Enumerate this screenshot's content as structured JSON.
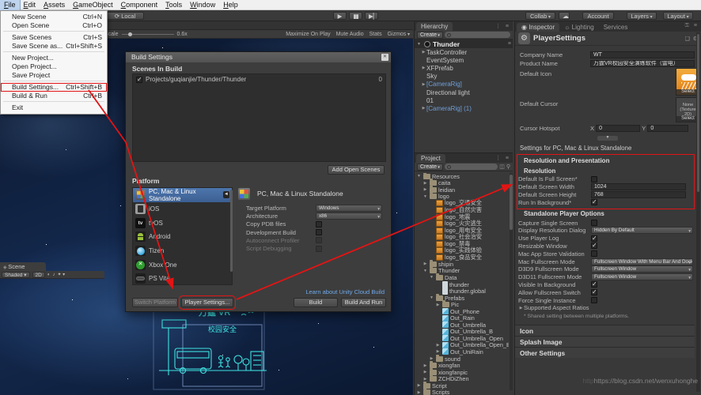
{
  "annotation_color": "#e21414",
  "window": {
    "watermark_ghost": "http",
    "watermark": "https://blog.csdn.net/wenxuhonghe"
  },
  "menu_bar": {
    "active": "File",
    "items": [
      "File",
      "Edit",
      "Assets",
      "GameObject",
      "Component",
      "Tools",
      "Window",
      "Help"
    ]
  },
  "toolbar": {
    "local_label": "Local",
    "collab_label": "Collab",
    "account_label": "Account",
    "layers_label": "Layers",
    "layout_label": "Layout"
  },
  "file_menu": {
    "items": [
      {
        "label": "New Scene",
        "shortcut": "Ctrl+N"
      },
      {
        "label": "Open Scene",
        "shortcut": "Ctrl+O",
        "sep": true
      },
      {
        "label": "Save Scenes",
        "shortcut": "Ctrl+S"
      },
      {
        "label": "Save Scene as...",
        "shortcut": "Ctrl+Shift+S",
        "sep": true
      },
      {
        "label": "New Project..."
      },
      {
        "label": "Open Project..."
      },
      {
        "label": "Save Project",
        "sep": true
      },
      {
        "label": "Build Settings...",
        "shortcut": "Ctrl+Shift+B",
        "boxed": true
      },
      {
        "label": "Build & Run",
        "shortcut": "Ctrl+B",
        "sep": true
      },
      {
        "label": "Exit"
      }
    ]
  },
  "game_view": {
    "scale_label": "Scale",
    "scale_value": "0.6x",
    "buttons": [
      "Maximize On Play",
      "Mute Audio",
      "Stats",
      "Gizmos"
    ],
    "logo_line1": "万霆 VR",
    "logo_line2": "校园安全"
  },
  "scene_view": {
    "tab": "Scene",
    "shading_label": "Shaded",
    "mode_2d_label": "2D"
  },
  "build_settings": {
    "title": "Build Settings",
    "scenes_in_build_label": "Scenes In Build",
    "scenes": [
      {
        "label": "Projects/guqianjie/Thunder/Thunder",
        "checked": true,
        "index": "0"
      }
    ],
    "add_open_scenes_label": "Add Open Scenes",
    "platform_label": "Platform",
    "platforms": [
      {
        "label": "PC, Mac & Linux Standalone",
        "icon": "pc",
        "selected": true
      },
      {
        "label": "iOS",
        "icon": "ios"
      },
      {
        "label": "tvOS",
        "icon": "tvos"
      },
      {
        "label": "Android",
        "icon": "android"
      },
      {
        "label": "Tizen",
        "icon": "tizen"
      },
      {
        "label": "Xbox One",
        "icon": "xbox"
      },
      {
        "label": "PS Vita",
        "icon": "psvita"
      }
    ],
    "selected_platform_title": "PC, Mac & Linux Standalone",
    "options": [
      {
        "type": "dropdown",
        "label": "Target Platform",
        "value": "Windows"
      },
      {
        "type": "dropdown",
        "label": "Architecture",
        "value": "x86"
      },
      {
        "type": "checkbox",
        "label": "Copy PDB files",
        "checked": false
      },
      {
        "type": "checkbox",
        "label": "Development Build",
        "checked": false
      },
      {
        "type": "checkbox",
        "label": "Autoconnect Profiler",
        "checked": false,
        "disabled": true
      },
      {
        "type": "checkbox",
        "label": "Script Debugging",
        "checked": false,
        "disabled": true
      }
    ],
    "cloud_link": "Learn about Unity Cloud Build",
    "switch_platform_label": "Switch Platform",
    "player_settings_label": "Player Settings...",
    "build_label": "Build",
    "build_and_run_label": "Build And Run"
  },
  "hierarchy": {
    "tab": "Hierarchy",
    "create_label": "Create",
    "scene_name": "Thunder",
    "items": [
      {
        "label": "TaskController",
        "arrow": true
      },
      {
        "label": "EventSystem"
      },
      {
        "label": "XFPrefab",
        "arrow": true
      },
      {
        "label": "Sky"
      },
      {
        "label": "[CameraRig]",
        "arrow": true,
        "prefab": true
      },
      {
        "label": "Directional light"
      },
      {
        "label": "01"
      },
      {
        "label": "[CameraRig] (1)",
        "arrow": true,
        "prefab": true
      }
    ]
  },
  "project": {
    "tab": "Project",
    "create_label": "Create",
    "items": [
      {
        "label": "Resources",
        "icon": "folder",
        "indent": 0,
        "arrow": "open"
      },
      {
        "label": "caita",
        "icon": "folder",
        "indent": 1,
        "arrow": "closed"
      },
      {
        "label": "leidian",
        "icon": "folder",
        "indent": 1,
        "arrow": "closed"
      },
      {
        "label": "logo",
        "icon": "folder",
        "indent": 1,
        "arrow": "open"
      },
      {
        "label": "logo_交通安全",
        "icon": "image",
        "indent": 2
      },
      {
        "label": "logo_自然灾害",
        "icon": "image",
        "indent": 2
      },
      {
        "label": "logo_地震",
        "icon": "image",
        "indent": 2
      },
      {
        "label": "logo_火灾逃生",
        "icon": "image",
        "indent": 2
      },
      {
        "label": "logo_用电安全",
        "icon": "image",
        "indent": 2
      },
      {
        "label": "logo_社会治安",
        "icon": "image",
        "indent": 2
      },
      {
        "label": "logo_禁毒",
        "icon": "image",
        "indent": 2
      },
      {
        "label": "logo_实践体验",
        "icon": "image",
        "indent": 2
      },
      {
        "label": "logo_食品安全",
        "icon": "image",
        "indent": 2
      },
      {
        "label": "shipin",
        "icon": "folder",
        "indent": 1,
        "arrow": "closed"
      },
      {
        "label": "Thunder",
        "icon": "folder",
        "indent": 1,
        "arrow": "open"
      },
      {
        "label": "Data",
        "icon": "folder",
        "indent": 2,
        "arrow": "open"
      },
      {
        "label": "thunder",
        "icon": "file",
        "indent": 3
      },
      {
        "label": "thunder.global",
        "icon": "file",
        "indent": 3
      },
      {
        "label": "Prefabs",
        "icon": "folder",
        "indent": 2,
        "arrow": "open"
      },
      {
        "label": "Pic",
        "icon": "folder",
        "indent": 3,
        "arrow": "closed"
      },
      {
        "label": "Out_Phone",
        "icon": "prefab",
        "indent": 3
      },
      {
        "label": "Out_Rain",
        "icon": "prefab",
        "indent": 3
      },
      {
        "label": "Out_Umbrella",
        "icon": "prefab",
        "indent": 3
      },
      {
        "label": "Out_Umbrella_B",
        "icon": "prefab",
        "indent": 3
      },
      {
        "label": "Out_Umbrella_Open",
        "icon": "prefab",
        "indent": 3
      },
      {
        "label": "Out_Umbrella_Open_B",
        "icon": "prefab",
        "indent": 3,
        "arrow": "closed"
      },
      {
        "label": "Out_UniRain",
        "icon": "prefab",
        "indent": 3,
        "arrow": "closed"
      },
      {
        "label": "sound",
        "icon": "folder",
        "indent": 2,
        "arrow": "closed"
      },
      {
        "label": "xiongfan",
        "icon": "folder",
        "indent": 1,
        "arrow": "closed"
      },
      {
        "label": "xiongfanpic",
        "icon": "folder",
        "indent": 1,
        "arrow": "closed"
      },
      {
        "label": "ZCHDiZhen",
        "icon": "folder",
        "indent": 1,
        "arrow": "closed"
      },
      {
        "label": "Script",
        "icon": "folder",
        "indent": 0,
        "arrow": "closed"
      },
      {
        "label": "Scripts",
        "icon": "folder",
        "indent": 0,
        "arrow": "closed"
      }
    ]
  },
  "inspector": {
    "tabs": [
      "Inspector",
      "Lighting",
      "Services"
    ],
    "component_title": "PlayerSettings",
    "company_name_label": "Company Name",
    "company_name": "WT",
    "product_name_label": "Product Name",
    "product_name": "万霆VR校园安全演练软件（雷电）",
    "default_icon_label": "Default Icon",
    "default_cursor_label": "Default Cursor",
    "cursor_none_text": "None (Texture 2D)",
    "select_label": "Select",
    "cursor_hotspot_label": "Cursor Hotspot",
    "hotspot_x_label": "X",
    "hotspot_x": "0",
    "hotspot_y_label": "Y",
    "hotspot_y": "0",
    "settings_for": "Settings for PC, Mac & Linux Standalone",
    "properties": [
      {
        "type": "header",
        "label": "Resolution and Presentation"
      },
      {
        "type": "subheader",
        "label": "Resolution"
      },
      {
        "type": "checkbox",
        "label": "Default Is Full Screen*",
        "checked": false
      },
      {
        "type": "field",
        "label": "Default Screen Width",
        "value": "1024"
      },
      {
        "type": "field",
        "label": "Default Screen Height",
        "value": "768"
      },
      {
        "type": "checkbox",
        "label": "Run In Background*",
        "checked": true
      },
      {
        "type": "subheader2",
        "label": "Standalone Player Options"
      },
      {
        "type": "checkbox",
        "label": "Capture Single Screen",
        "checked": false
      },
      {
        "type": "dropdown",
        "label": "Display Resolution Dialog",
        "value": "Hidden By Default"
      },
      {
        "type": "checkbox",
        "label": "Use Player Log",
        "checked": true
      },
      {
        "type": "checkbox",
        "label": "Resizable Window",
        "checked": true
      },
      {
        "type": "checkbox",
        "label": "Mac App Store Validation",
        "checked": false
      },
      {
        "type": "dropdown",
        "label": "Mac Fullscreen Mode",
        "value": "Fullscreen Window With Menu Bar And Dock"
      },
      {
        "type": "dropdown",
        "label": "D3D9 Fullscreen Mode",
        "value": "Fullscreen Window"
      },
      {
        "type": "dropdown",
        "label": "D3D11 Fullscreen Mode",
        "value": "Fullscreen Window"
      },
      {
        "type": "checkbox",
        "label": "Visible In Background",
        "checked": true
      },
      {
        "type": "checkbox",
        "label": "Allow Fullscreen Switch",
        "checked": true
      },
      {
        "type": "checkbox",
        "label": "Force Single Instance",
        "checked": false
      },
      {
        "type": "foldout",
        "label": "Supported Aspect Ratios"
      },
      {
        "type": "note",
        "label": "* Shared setting between multiple platforms."
      }
    ],
    "sections": [
      "Icon",
      "Splash Image",
      "Other Settings"
    ]
  }
}
